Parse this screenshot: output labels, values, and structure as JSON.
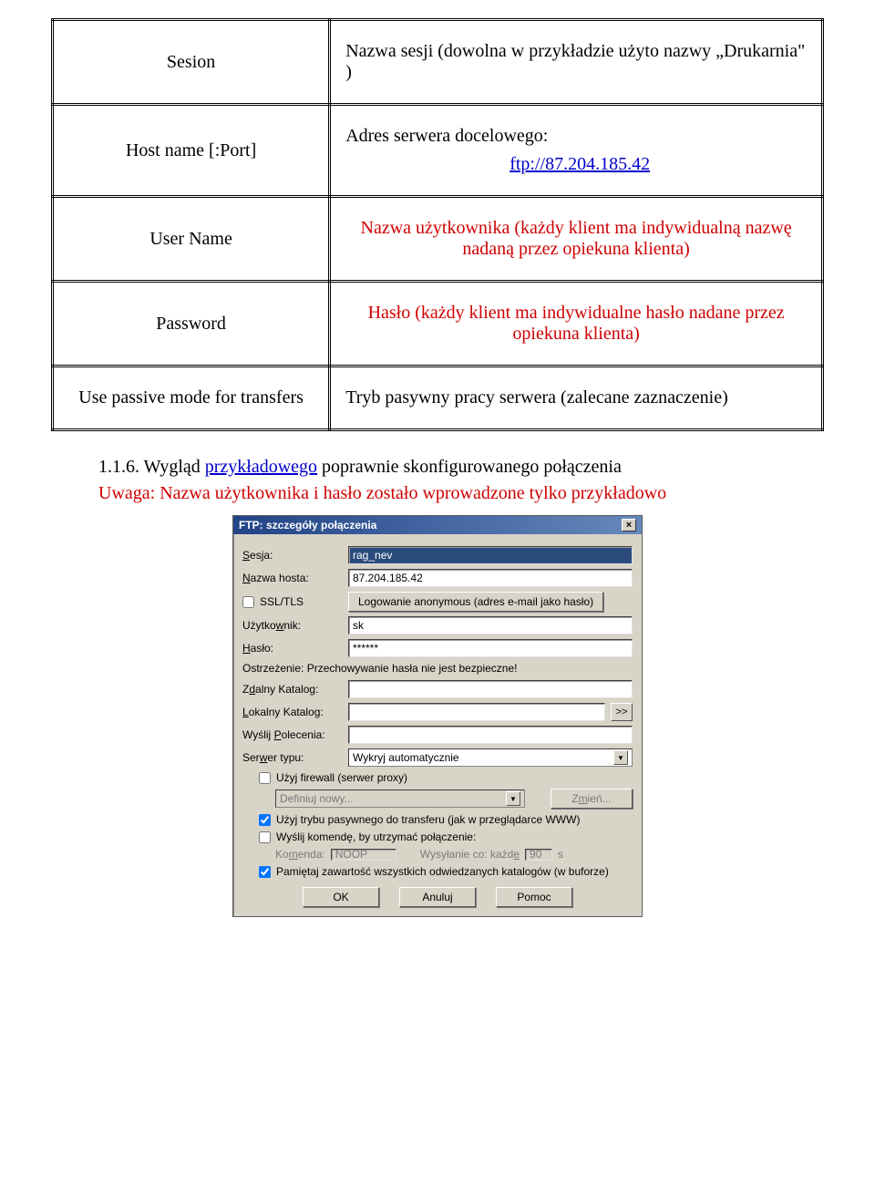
{
  "table": {
    "r1_left": "Sesion",
    "r1_right": "Nazwa sesji (dowolna w przykładzie użyto nazwy „Drukarnia\" )",
    "r2_left": "Host name [:Port]",
    "r2_right_top": "Adres serwera docelowego:",
    "r2_right_link": "ftp://87.204.185.42",
    "r3_left": "User Name",
    "r3_right": "Nazwa użytkownika (każdy klient ma indywidualną nazwę nadaną przez opiekuna klienta)",
    "r4_left": "Password",
    "r4_right": "Hasło (każdy klient ma indywidualne hasło nadane przez opiekuna klienta)",
    "r5_left": "Use passive mode for transfers",
    "r5_right": "Tryb pasywny pracy serwera (zalecane zaznaczenie)"
  },
  "para": {
    "num": "1.1.6.",
    "t1a": "Wygląd ",
    "t1b": "przykładowego",
    "t1c": " poprawnie skonfigurowanego połączenia",
    "t2": "Uwaga: Nazwa użytkownika i hasło zostało wprowadzone tylko przykładowo"
  },
  "dlg": {
    "title": "FTP: szczegóły połączenia",
    "close": "×",
    "lbl_sesja_pre": "S",
    "lbl_sesja_rest": "esja:",
    "val_sesja": "rag_nev",
    "lbl_host_pre": "N",
    "lbl_host_rest": "azwa hosta:",
    "val_host": "87.204.185.42",
    "ssltls": "SSL/TLS",
    "anon_btn": "Logowanie anonymous (adres e-mail jako hasło)",
    "lbl_user_a": "Użytko",
    "lbl_user_u": "w",
    "lbl_user_b": "nik:",
    "val_user": "sk",
    "lbl_pass_u": "H",
    "lbl_pass_rest": "asło:",
    "val_pass": "******",
    "warn": "Ostrzeżenie: Przechowywanie hasła nie jest bezpieczne!",
    "lbl_remote_a": "Z",
    "lbl_remote_u": "d",
    "lbl_remote_b": "alny Katalog:",
    "lbl_local_u": "L",
    "lbl_local_rest": "okalny Katalog:",
    "local_btn": ">>",
    "lbl_cmd_a": "Wyślij ",
    "lbl_cmd_u": "P",
    "lbl_cmd_b": "olecenia:",
    "lbl_type_a": "Ser",
    "lbl_type_u": "w",
    "lbl_type_b": "er typu:",
    "val_type": "Wykryj automatycznie",
    "cb_fw_a": "Uży",
    "cb_fw_u": "j",
    "cb_fw_b": " firewall (serwer proxy)",
    "fw_dd": "Definiuj nowy...",
    "fw_btn_a": "Z",
    "fw_btn_u": "m",
    "fw_btn_b": "ień...",
    "cb_pasv": "Użyj trybu pasywnego do transferu (jak w przeglądarce WWW)",
    "cb_keep": "Wyślij komendę, by utrzymać połączenie:",
    "keep_lbl_a": "Ko",
    "keep_lbl_u": "m",
    "keep_lbl_b": "enda:",
    "keep_val": "NOOP",
    "keep_every_a": "Wysyłanie co: każd",
    "keep_every_u": "e",
    "keep_int": "90",
    "keep_s": "s",
    "cb_cache": "Pamiętaj zawartość wszystkich odwiedzanych katalogów (w buforze)",
    "ok": "OK",
    "cancel": "Anuluj",
    "help": "Pomoc"
  }
}
